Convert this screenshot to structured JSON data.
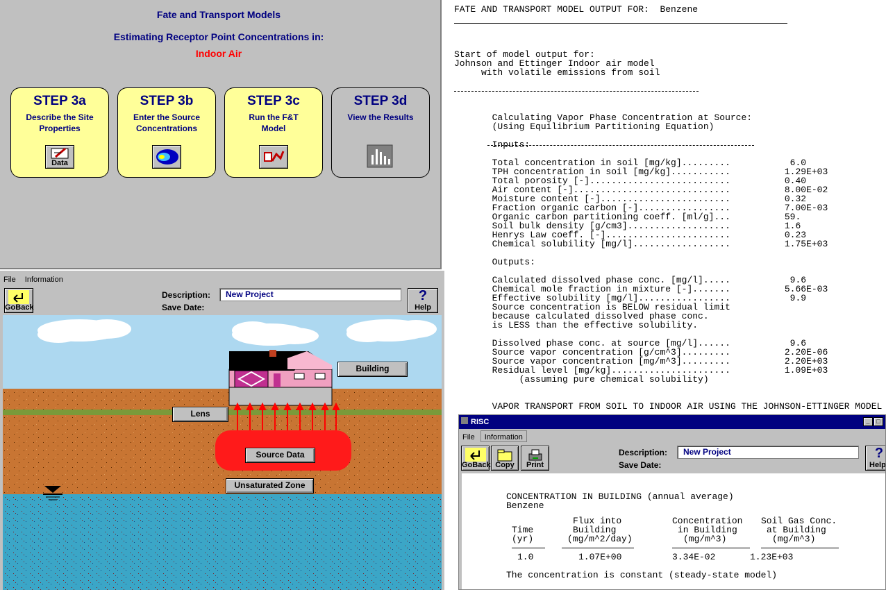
{
  "ft_panel": {
    "title": "Fate and Transport Models",
    "subtitle": "Estimating Receptor Point Concentrations in:",
    "medium": "Indoor Air",
    "steps": [
      {
        "title": "STEP 3a",
        "line1": "Describe the Site",
        "line2": "Properties",
        "button_label": "Data"
      },
      {
        "title": "STEP 3b",
        "line1": "Enter the Source",
        "line2": "Concentrations",
        "button_label": ""
      },
      {
        "title": "STEP 3c",
        "line1": "Run the F&T",
        "line2": "Model",
        "button_label": ""
      },
      {
        "title": "STEP 3d",
        "line1": "View the Results",
        "line2": "",
        "button_label": ""
      }
    ]
  },
  "scene_window": {
    "menu": {
      "file": "File",
      "information": "Information"
    },
    "goback_label": "GoBack",
    "help_label": "Help",
    "description_label": "Description:",
    "description_value": "New Project",
    "save_date_label": "Save Date:",
    "buttons": {
      "building": "Building",
      "lens": "Lens",
      "source_data": "Source Data",
      "unsaturated_zone": "Unsaturated Zone"
    }
  },
  "output": {
    "lines": [
      "FATE AND TRANSPORT MODEL OUTPUT FOR:  Benzene",
      "",
      "",
      "",
      "",
      "Start of model output for:",
      "Johnson and Ettinger Indoor air model",
      "     with volatile emissions from soil",
      "",
      "",
      "",
      "",
      "       Calculating Vapor Phase Concentration at Source:",
      "       (Using Equilibrium Partitioning Equation)",
      "",
      "       Inputs:",
      "",
      "       Total concentration in soil [mg/kg].........           6.0",
      "       TPH concentration in soil [mg/kg]...........          1.29E+03",
      "       Total porosity [-]..........................          0.40",
      "       Air content [-].............................          8.00E-02",
      "       Moisture content [-]........................          0.32",
      "       Fraction organic carbon [-].................          7.00E-03",
      "       Organic carbon partitioning coeff. [ml/g]...          59.",
      "       Soil bulk density [g/cm3]...................          1.6",
      "       Henrys Law coeff. [-].......................          0.23",
      "       Chemical solubility [mg/l]..................          1.75E+03",
      "",
      "       Outputs:",
      "",
      "       Calculated dissolved phase conc. [mg/l].....           9.6",
      "       Chemical mole fraction in mixture [-].......          5.66E-03",
      "       Effective solubility [mg/l].................           9.9",
      "       Source concentration is BELOW residual limit",
      "       because calculated dissolved phase conc.",
      "       is LESS than the effective solubility.",
      "",
      "       Dissolved phase conc. at source [mg/l]......           9.6",
      "       Source vapor concentration [g/cm^3].........          2.20E-06",
      "       Source vapor concentration [mg/m^3].........          2.20E+03",
      "       Residual level [mg/kg]......................          1.09E+03",
      "            (assuming pure chemical solubility)",
      "",
      "",
      "       VAPOR TRANSPORT FROM SOIL TO INDOOR AIR USING THE JOHNSON-ETTINGER MODEL"
    ]
  },
  "risc_window": {
    "title": "RISC",
    "menu": {
      "file": "File",
      "information": "Information"
    },
    "buttons": {
      "goback": "GoBack",
      "copy": "Copy",
      "print": "Print",
      "help": "Help"
    },
    "description_label": "Description:",
    "description_value": "New Project",
    "save_date_label": "Save Date:",
    "report": {
      "heading": "CONCENTRATION IN BUILDING (annual average)",
      "chemical": "Benzene",
      "col_time": [
        "Time",
        "(yr)"
      ],
      "col_flux": [
        "Flux into",
        "Building",
        "(mg/m^2/day)"
      ],
      "col_conc": [
        "Concentration",
        "in Building",
        "(mg/m^3)"
      ],
      "col_soilgas": [
        "Soil Gas Conc.",
        "at Building",
        "(mg/m^3)"
      ],
      "row": {
        "time": "1.0",
        "flux": "1.07E+00",
        "conc": "3.34E-02",
        "soilgas": "1.23E+03"
      },
      "note": "The concentration is constant (steady-state model)"
    }
  },
  "colors": {
    "panel_gray": "#c0c0c0",
    "step_yellow": "#ffff99",
    "title_navy": "#000080",
    "medium_red": "#ff0000",
    "sky": "#add8f0",
    "soil": "#c87533",
    "water": "#3ba6c7",
    "source_red": "#ff1a1a"
  }
}
